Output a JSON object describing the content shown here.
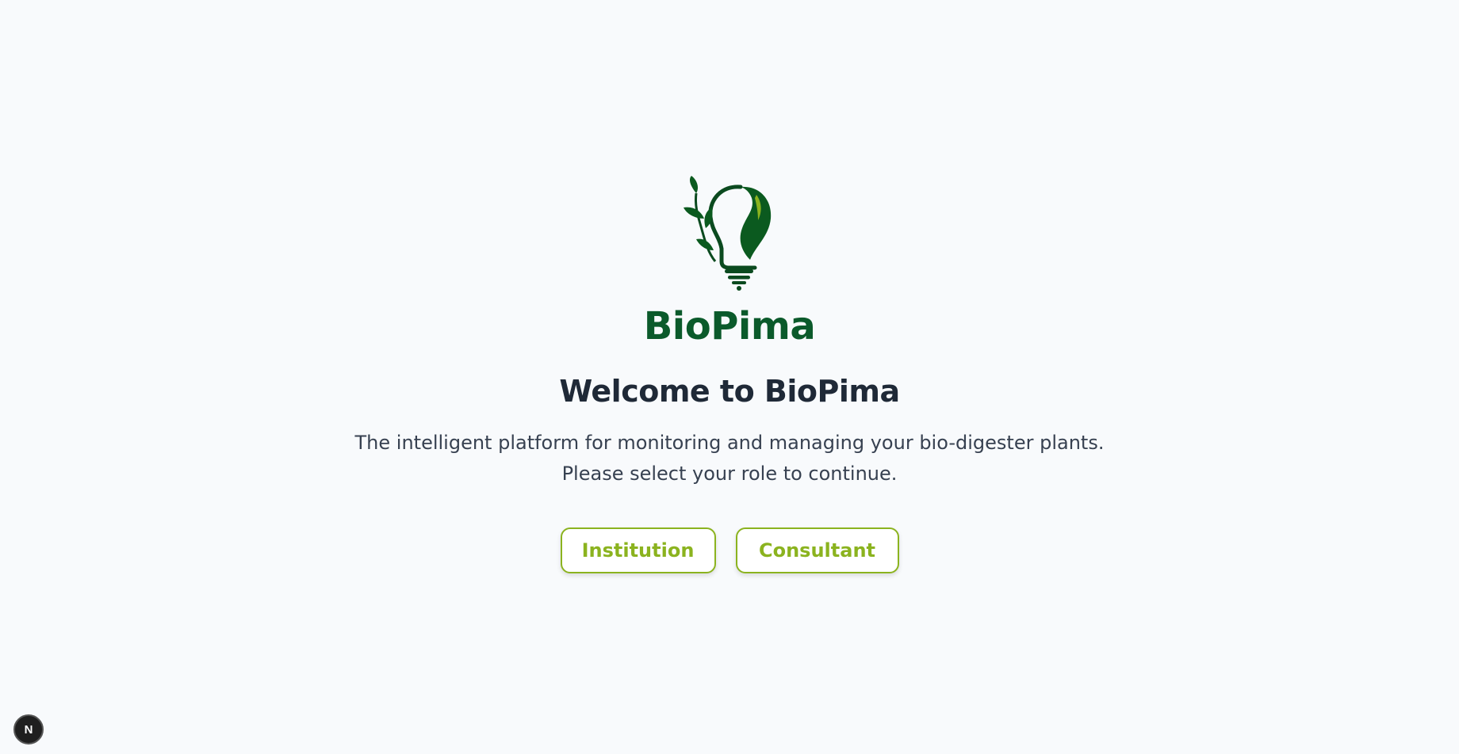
{
  "brand": {
    "name": "BioPima",
    "logo_icon": "lightbulb-leaf-logo",
    "primary_color": "#0b5a2b",
    "accent_color": "#8bb31f"
  },
  "welcome": {
    "title": "Welcome to BioPima",
    "subtitle_line1": "The intelligent platform for monitoring and managing your bio-digester plants.",
    "subtitle_line2": "Please select your role to continue."
  },
  "roles": {
    "institution_label": "Institution",
    "consultant_label": "Consultant"
  },
  "dev_indicator": {
    "label": "N"
  }
}
